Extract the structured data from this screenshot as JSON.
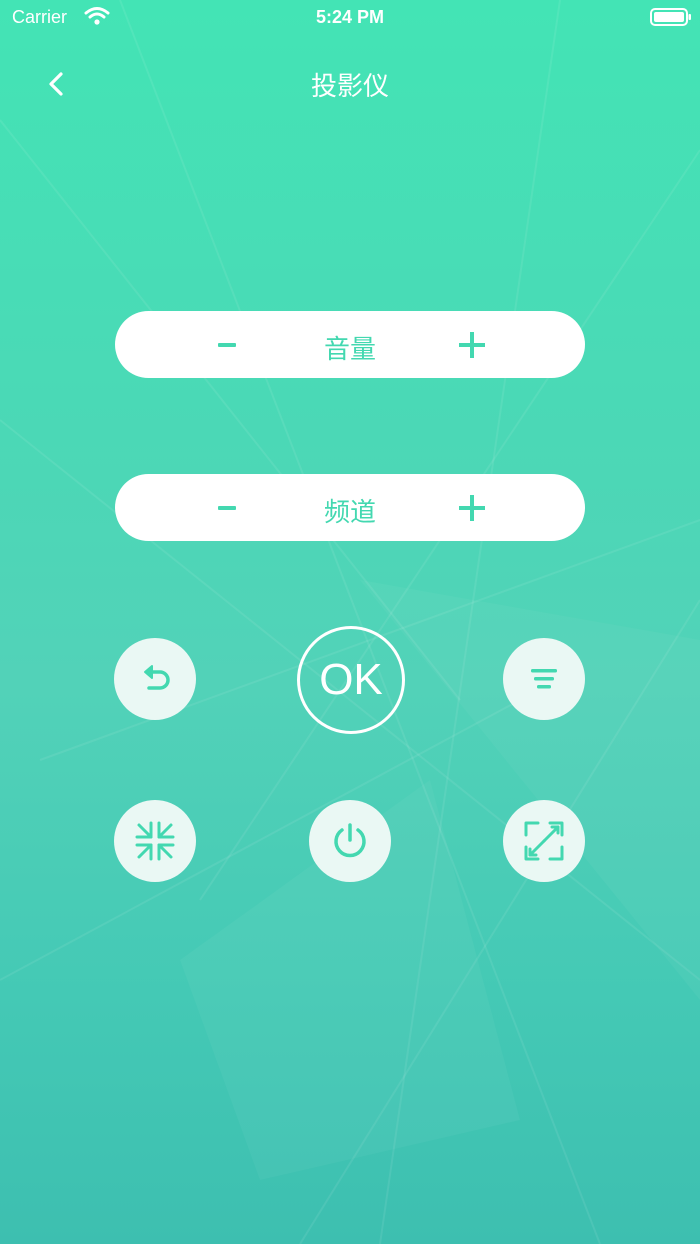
{
  "status_bar": {
    "carrier": "Carrier",
    "time": "5:24 PM"
  },
  "nav": {
    "title": "投影仪",
    "back_icon": "chevron-left-icon"
  },
  "controls": {
    "volume": {
      "label": "音量",
      "minus_icon": "minus-icon",
      "plus_icon": "plus-icon"
    },
    "channel": {
      "label": "频道",
      "minus_icon": "minus-icon",
      "plus_icon": "plus-icon"
    },
    "ok_label": "OK",
    "buttons": [
      {
        "icon": "return-icon"
      },
      {
        "icon": "menu-icon"
      },
      {
        "icon": "shrink-icon"
      },
      {
        "icon": "power-icon"
      },
      {
        "icon": "expand-icon"
      }
    ]
  },
  "colors": {
    "accent": "#43d8b0",
    "background_top": "#43e4b5",
    "background_bottom": "#3dbfb0",
    "button_fill": "#eaf8f4"
  }
}
